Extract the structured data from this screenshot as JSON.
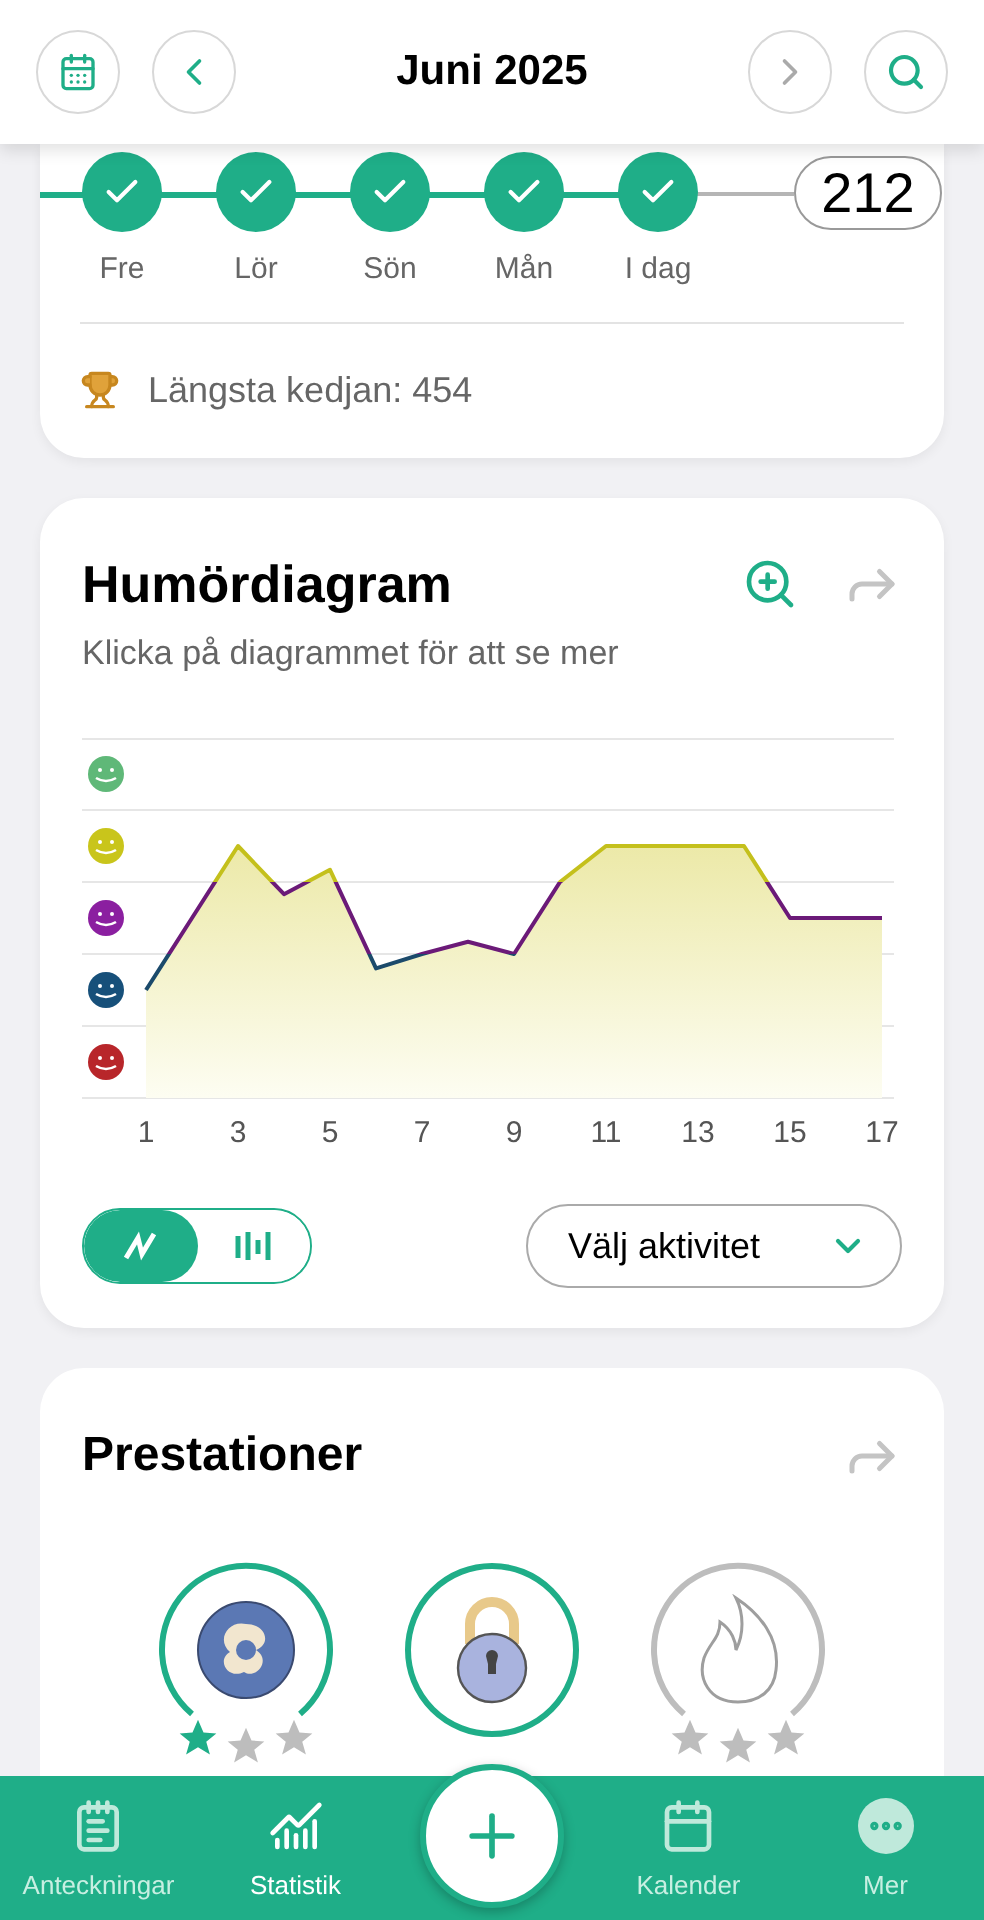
{
  "header": {
    "title": "Juni 2025"
  },
  "streak": {
    "days": [
      {
        "label": "Fre",
        "checked": true
      },
      {
        "label": "Lör",
        "checked": true
      },
      {
        "label": "Sön",
        "checked": true
      },
      {
        "label": "Mån",
        "checked": true
      },
      {
        "label": "I dag",
        "checked": true
      }
    ],
    "count": "212",
    "longest": "Längsta kedjan: 454"
  },
  "mood_chart": {
    "title": "Humördiagram",
    "subtitle": "Klicka på diagrammet för att se mer",
    "x_labels": [
      "1",
      "3",
      "5",
      "7",
      "9",
      "11",
      "13",
      "15",
      "17"
    ],
    "view_toggle": [
      {
        "kind": "line",
        "selected": true
      },
      {
        "kind": "bar",
        "selected": false
      }
    ],
    "activity_select": "Välj aktivitet"
  },
  "achievements": {
    "title": "Prestationer",
    "badges": [
      {
        "kind": "swirl",
        "earned": true,
        "stars": 1
      },
      {
        "kind": "lock",
        "earned": true
      },
      {
        "kind": "flame",
        "earned": false,
        "stars": 0
      }
    ]
  },
  "nav": [
    {
      "kind": "notes",
      "label": "Anteckningar",
      "selected": false
    },
    {
      "kind": "stats",
      "label": "Statistik",
      "selected": true
    },
    {
      "kind": "add"
    },
    {
      "kind": "calendar",
      "label": "Kalender",
      "selected": false
    },
    {
      "kind": "more",
      "label": "Mer",
      "selected": false
    }
  ]
}
